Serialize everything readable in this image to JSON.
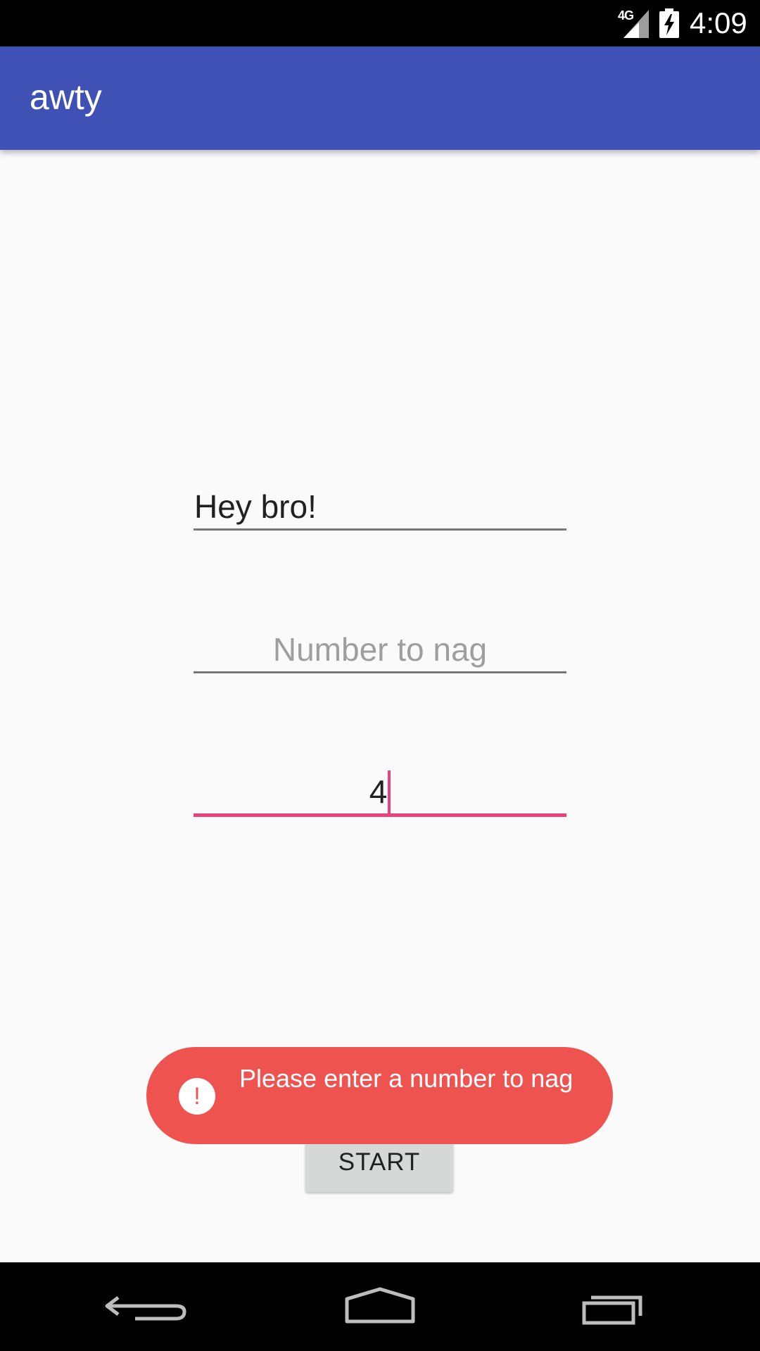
{
  "status_bar": {
    "network_label": "4G",
    "time": "4:09"
  },
  "app_bar": {
    "title": "awty"
  },
  "form": {
    "message_value": "Hey bro!",
    "phone_placeholder": "Number to nag",
    "interval_value": "4"
  },
  "start_button": {
    "label": "START"
  },
  "toast": {
    "icon_glyph": "!",
    "message": "Please enter a number to nag"
  },
  "nav_bar": {
    "icons": [
      "back-icon",
      "home-icon",
      "recents-icon"
    ]
  },
  "colors": {
    "app_bar": "#3f51b5",
    "accent": "#ec407a",
    "toast": "#ef5350",
    "background": "#fafafa"
  }
}
